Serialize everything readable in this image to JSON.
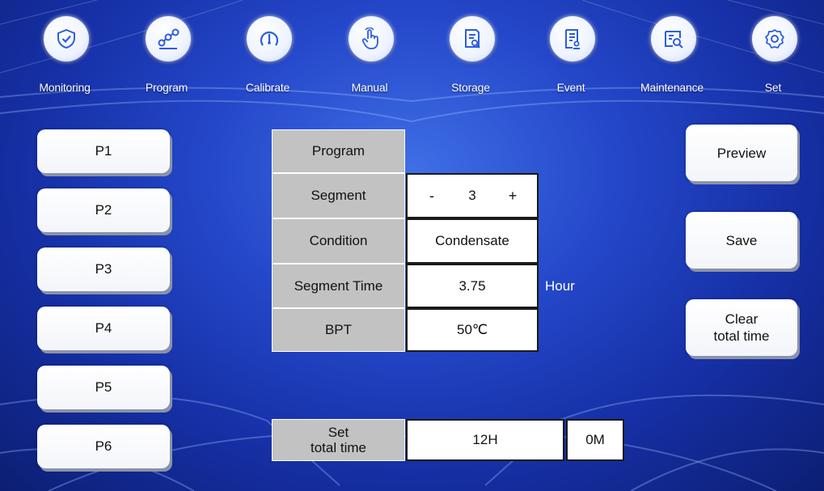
{
  "nav": {
    "items": [
      {
        "label": "Monitoring",
        "icon": "shield-check-icon"
      },
      {
        "label": "Program",
        "icon": "program-nodes-icon"
      },
      {
        "label": "Calibrate",
        "icon": "gauge-icon"
      },
      {
        "label": "Manual",
        "icon": "hand-pointer-icon"
      },
      {
        "label": "Storage",
        "icon": "storage-document-icon"
      },
      {
        "label": "Event",
        "icon": "event-document-icon"
      },
      {
        "label": "Maintenance",
        "icon": "maintenance-search-icon"
      },
      {
        "label": "Set",
        "icon": "gear-icon"
      }
    ]
  },
  "programs": [
    "P1",
    "P2",
    "P3",
    "P4",
    "P5",
    "P6"
  ],
  "table": {
    "program_label": "Program",
    "segment_label": "Segment",
    "segment_minus": "-",
    "segment_value": "3",
    "segment_plus": "+",
    "condition_label": "Condition",
    "condition_value": "Condensate",
    "segment_time_label": "Segment Time",
    "segment_time_value": "3.75",
    "segment_time_unit": "Hour",
    "bpt_label": "BPT",
    "bpt_value": "50℃"
  },
  "total": {
    "label": "Set\ntotal time",
    "hours": "12H",
    "minutes": "0M"
  },
  "actions": {
    "preview": "Preview",
    "save": "Save",
    "clear_total_time": "Clear\ntotal time"
  },
  "colors": {
    "background_center": "#3f6fe6",
    "background_edge": "#0c1e73",
    "label_cell": "#c2c2c2"
  }
}
